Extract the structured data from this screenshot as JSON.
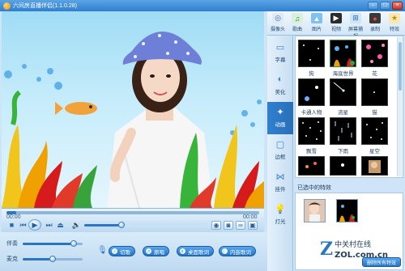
{
  "window": {
    "title": "六间房直播伴侣(1.1.0.28)",
    "minimize": "–",
    "maximize": "□",
    "close": "×"
  },
  "player": {
    "time_current": "00:00",
    "time_total": "00:00",
    "progress_fraction": 0.04,
    "volume_fraction": 0.95
  },
  "mixer": {
    "items": [
      {
        "label": "伴奏",
        "level_fraction": 0.85
      },
      {
        "label": "麦克",
        "level_fraction": 0.5
      }
    ]
  },
  "actions": [
    {
      "label": "切歌",
      "icon": "music-icon"
    },
    {
      "label": "原唱",
      "icon": "vocal-icon"
    },
    {
      "label": "桌面歌词",
      "icon": "lyrics-icon"
    },
    {
      "label": "内嵌歌词",
      "icon": "embed-lyrics-icon"
    }
  ],
  "toolbar": {
    "items": [
      {
        "label": "摄像头",
        "icon": "camera-icon"
      },
      {
        "label": "歌曲",
        "icon": "music-disc-icon"
      },
      {
        "label": "图片",
        "icon": "picture-icon"
      },
      {
        "label": "视频",
        "icon": "video-icon"
      },
      {
        "label": "屏幕捕捉",
        "icon": "screen-capture-icon"
      },
      {
        "label": "录制",
        "icon": "record-icon"
      },
      {
        "label": "特效",
        "icon": "effects-icon"
      }
    ]
  },
  "sidebar": {
    "items": [
      {
        "label": "字幕",
        "icon": "subtitle-icon"
      },
      {
        "label": "美化",
        "icon": "beautify-icon"
      },
      {
        "label": "动画",
        "icon": "animation-star-icon",
        "active": true
      },
      {
        "label": "边框",
        "icon": "frame-icon"
      },
      {
        "label": "挂件",
        "icon": "bow-icon"
      },
      {
        "label": "灯光",
        "icon": "light-bulb-icon"
      }
    ]
  },
  "effects": {
    "items": [
      {
        "label": "狗"
      },
      {
        "label": "海底世界"
      },
      {
        "label": "花"
      },
      {
        "label": "卡通人物"
      },
      {
        "label": "流星"
      },
      {
        "label": "猫"
      },
      {
        "label": "飘雪"
      },
      {
        "label": "下雨"
      },
      {
        "label": "星空"
      },
      {
        "label": ""
      },
      {
        "label": ""
      },
      {
        "label": ""
      }
    ]
  },
  "selected": {
    "title": "已选中的特效",
    "delete_label": "删除所有特效"
  },
  "watermark": {
    "brand": "中关村在线",
    "url": "ZOL.com.cn"
  },
  "colors": {
    "accent": "#2474c6",
    "panel_bg": "#cfe5f7",
    "titlebar": "#3f8fdc"
  }
}
